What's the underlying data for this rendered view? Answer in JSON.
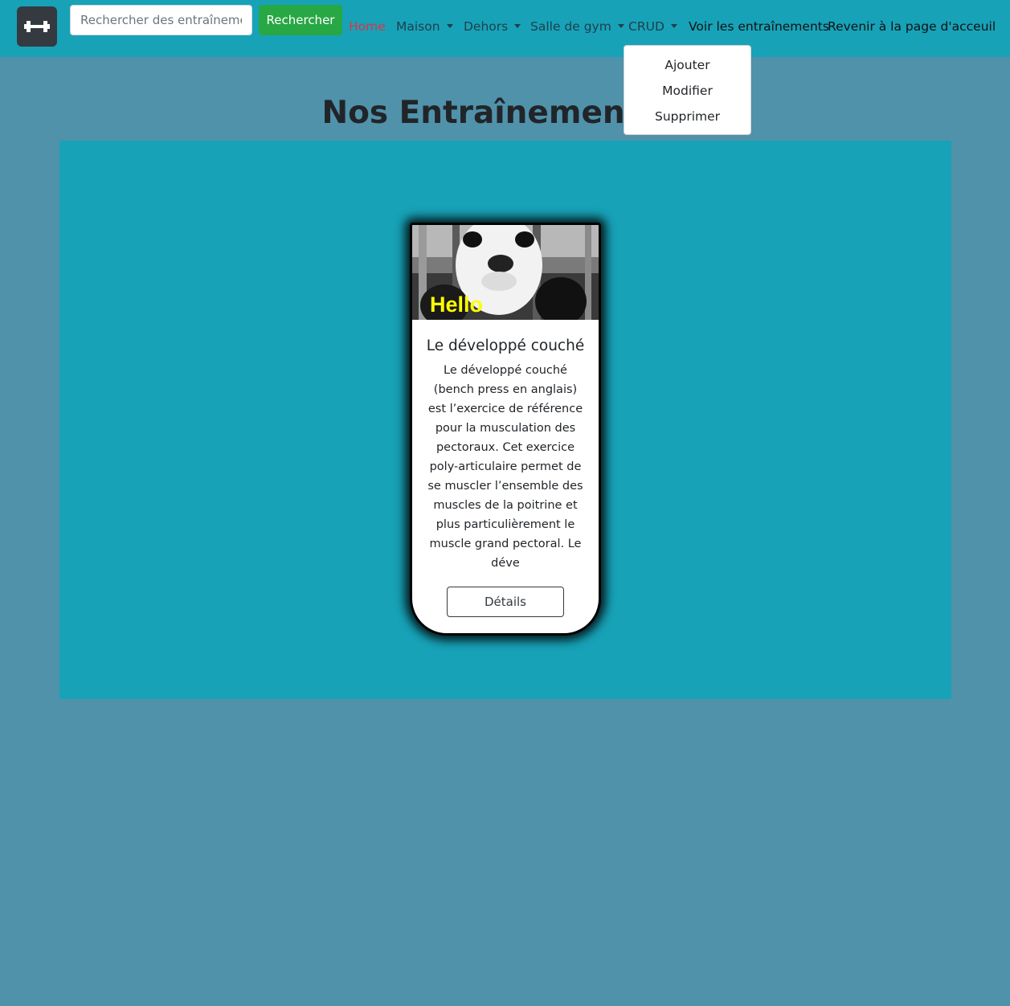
{
  "navbar": {
    "brand_icon": "dumbbell-icon",
    "search": {
      "placeholder": "Rechercher des entraînements",
      "value": ""
    },
    "search_button": "Rechercher",
    "links": {
      "home": "Home",
      "maison": "Maison",
      "dehors": "Dehors",
      "salle": "Salle de gym",
      "crud": "CRUD",
      "voir": "Voir les entraînements",
      "revenir": "Revenir à la page d'acceuil"
    },
    "crud_menu": [
      "Ajouter",
      "Modifier",
      "Supprimer"
    ],
    "colors": {
      "navbar": "#17a2b8",
      "active_link": "#dc3545",
      "search_button": "#28a745"
    }
  },
  "main": {
    "title": "Nos Entraînements",
    "background": "#5092aa",
    "panel_color": "#17a2b8"
  },
  "card": {
    "image_overlay": "Hello",
    "title": "Le développé couché",
    "text": "Le développé couché (bench press en anglais) est l’exercice de référence pour la musculation des pectoraux. Cet exercice poly-articulaire permet de se muscler l’ensemble des muscles de la poitrine et plus particulièrement le muscle grand pectoral. Le déve",
    "button": "Détails"
  }
}
